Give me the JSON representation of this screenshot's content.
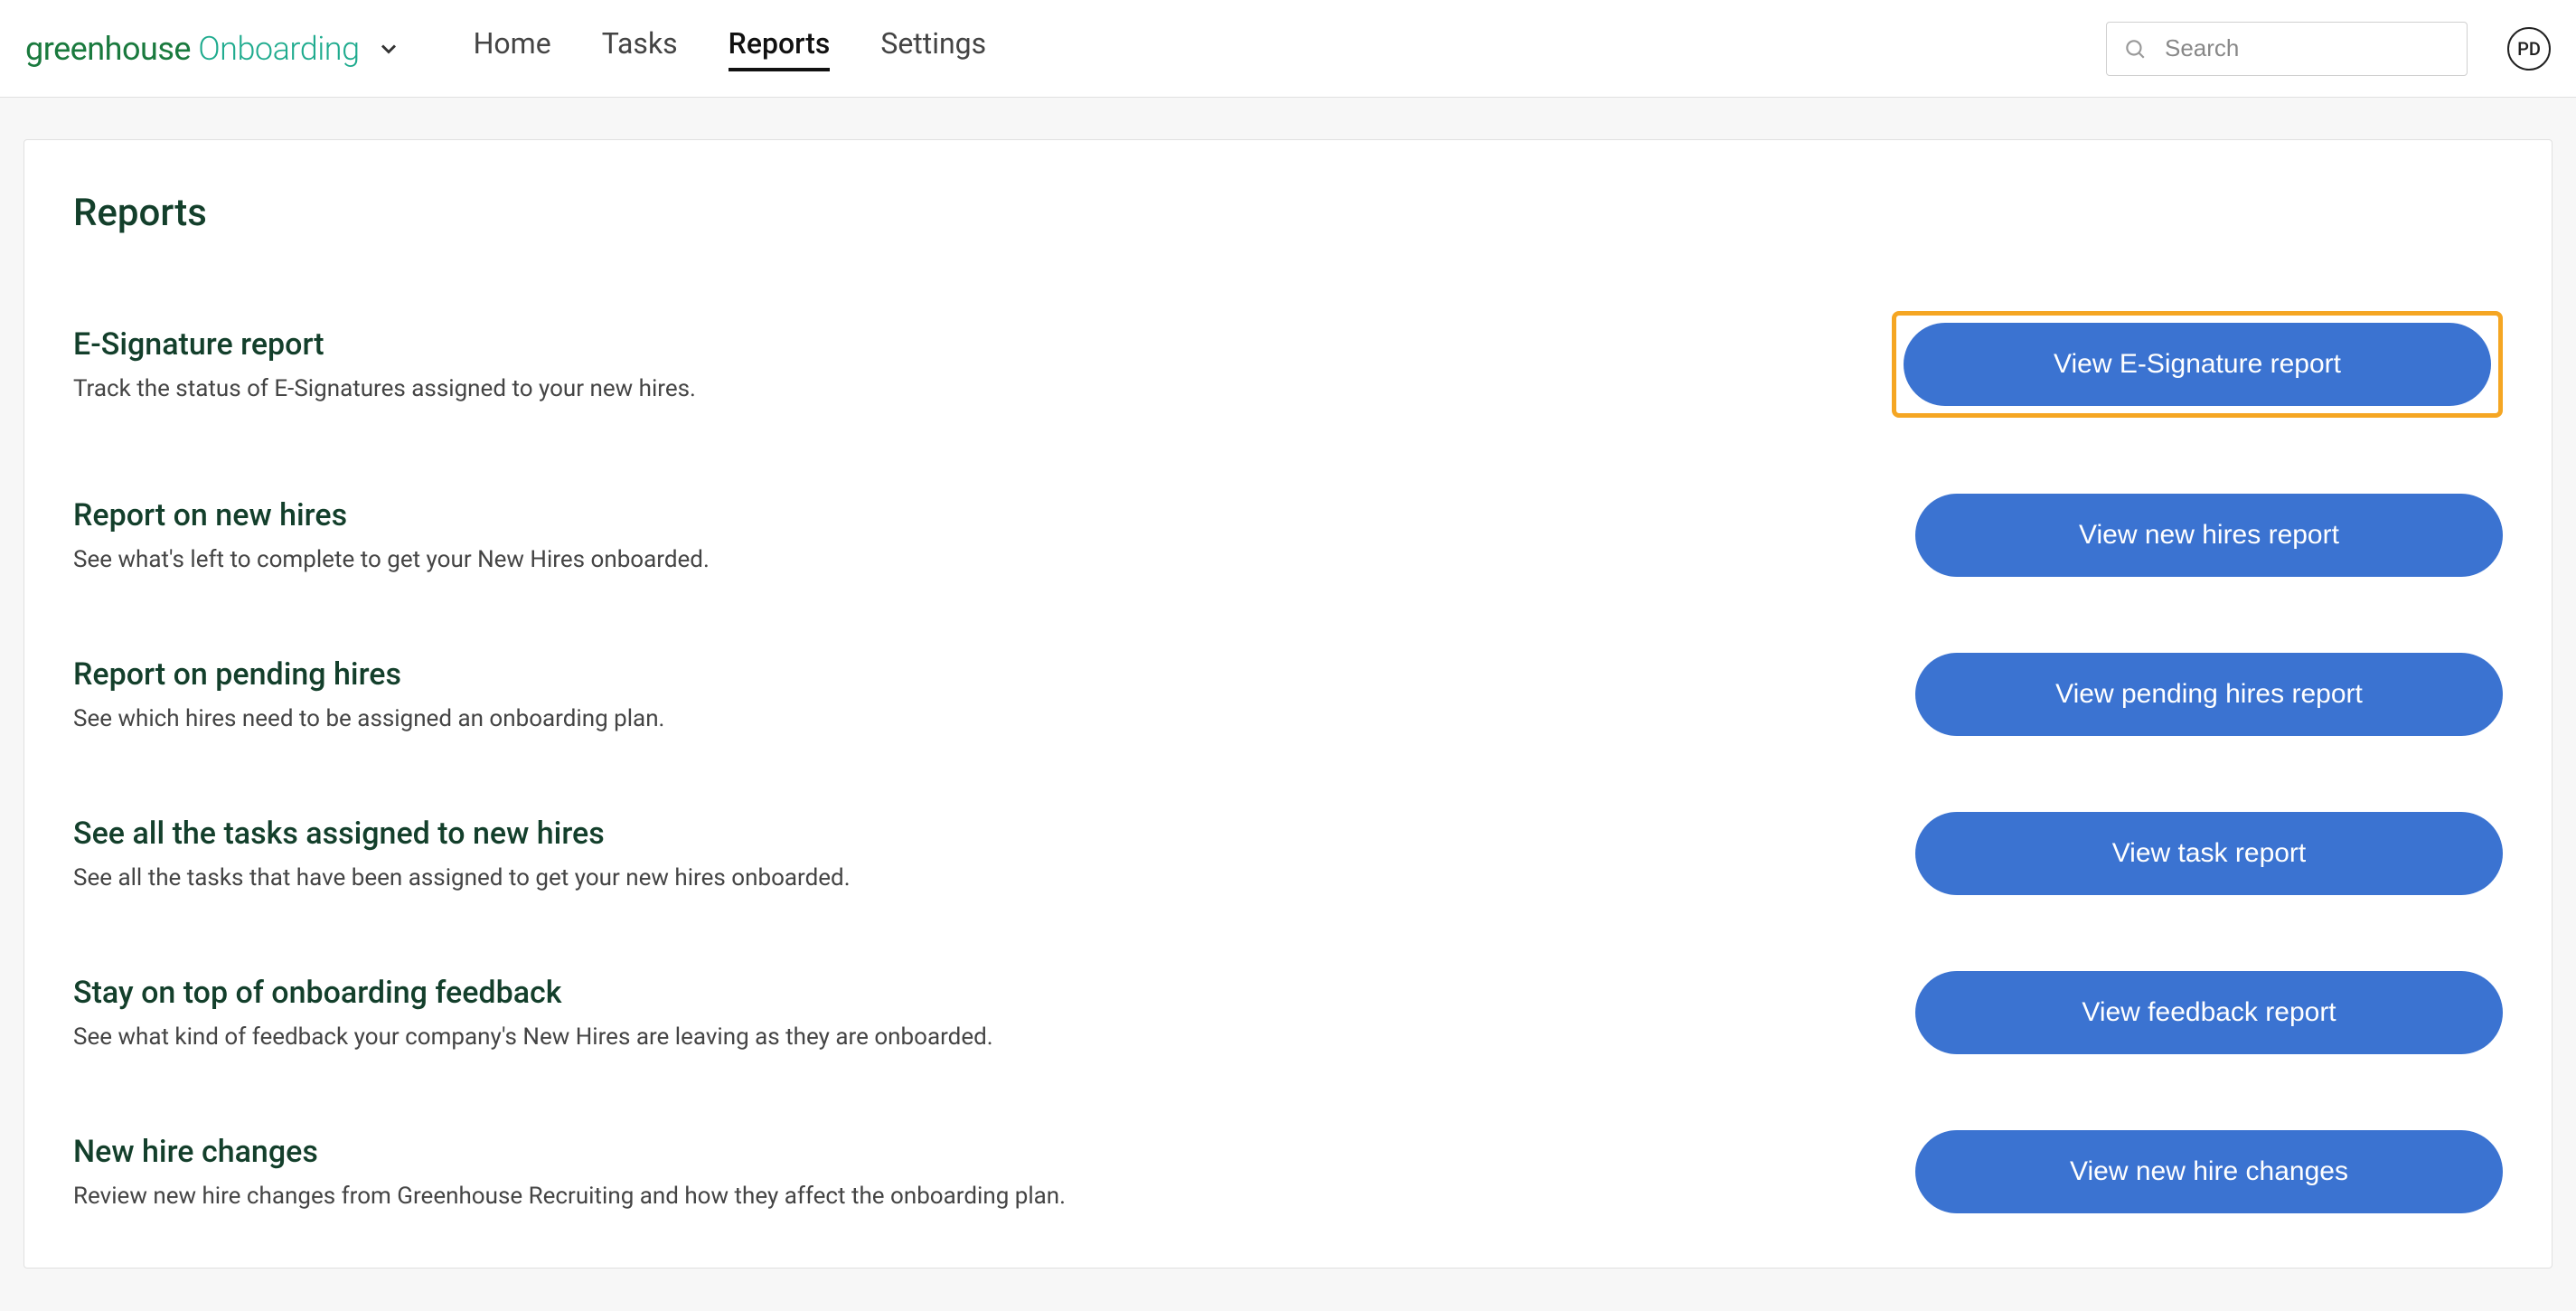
{
  "brand": {
    "word1": "greenhouse",
    "word2": " Onboarding"
  },
  "nav": {
    "items": [
      {
        "label": "Home",
        "id": "home",
        "active": false
      },
      {
        "label": "Tasks",
        "id": "tasks",
        "active": false
      },
      {
        "label": "Reports",
        "id": "reports",
        "active": true
      },
      {
        "label": "Settings",
        "id": "settings",
        "active": false
      }
    ]
  },
  "search": {
    "placeholder": "Search"
  },
  "user": {
    "initials": "PD"
  },
  "page": {
    "title": "Reports"
  },
  "reports": [
    {
      "id": "esignature",
      "title": "E-Signature report",
      "desc": "Track the status of E-Signatures assigned to your new hires.",
      "button": "View E-Signature report",
      "highlighted": true
    },
    {
      "id": "new-hires",
      "title": "Report on new hires",
      "desc": "See what's left to complete to get your New Hires onboarded.",
      "button": "View new hires report",
      "highlighted": false
    },
    {
      "id": "pending-hires",
      "title": "Report on pending hires",
      "desc": "See which hires need to be assigned an onboarding plan.",
      "button": "View pending hires report",
      "highlighted": false
    },
    {
      "id": "tasks",
      "title": "See all the tasks assigned to new hires",
      "desc": "See all the tasks that have been assigned to get your new hires onboarded.",
      "button": "View task report",
      "highlighted": false
    },
    {
      "id": "feedback",
      "title": "Stay on top of onboarding feedback",
      "desc": "See what kind of feedback your company's New Hires are leaving as they are onboarded.",
      "button": "View feedback report",
      "highlighted": false
    },
    {
      "id": "changes",
      "title": "New hire changes",
      "desc": "Review new hire changes from Greenhouse Recruiting and how they affect the onboarding plan.",
      "button": "View new hire changes",
      "highlighted": false
    }
  ]
}
